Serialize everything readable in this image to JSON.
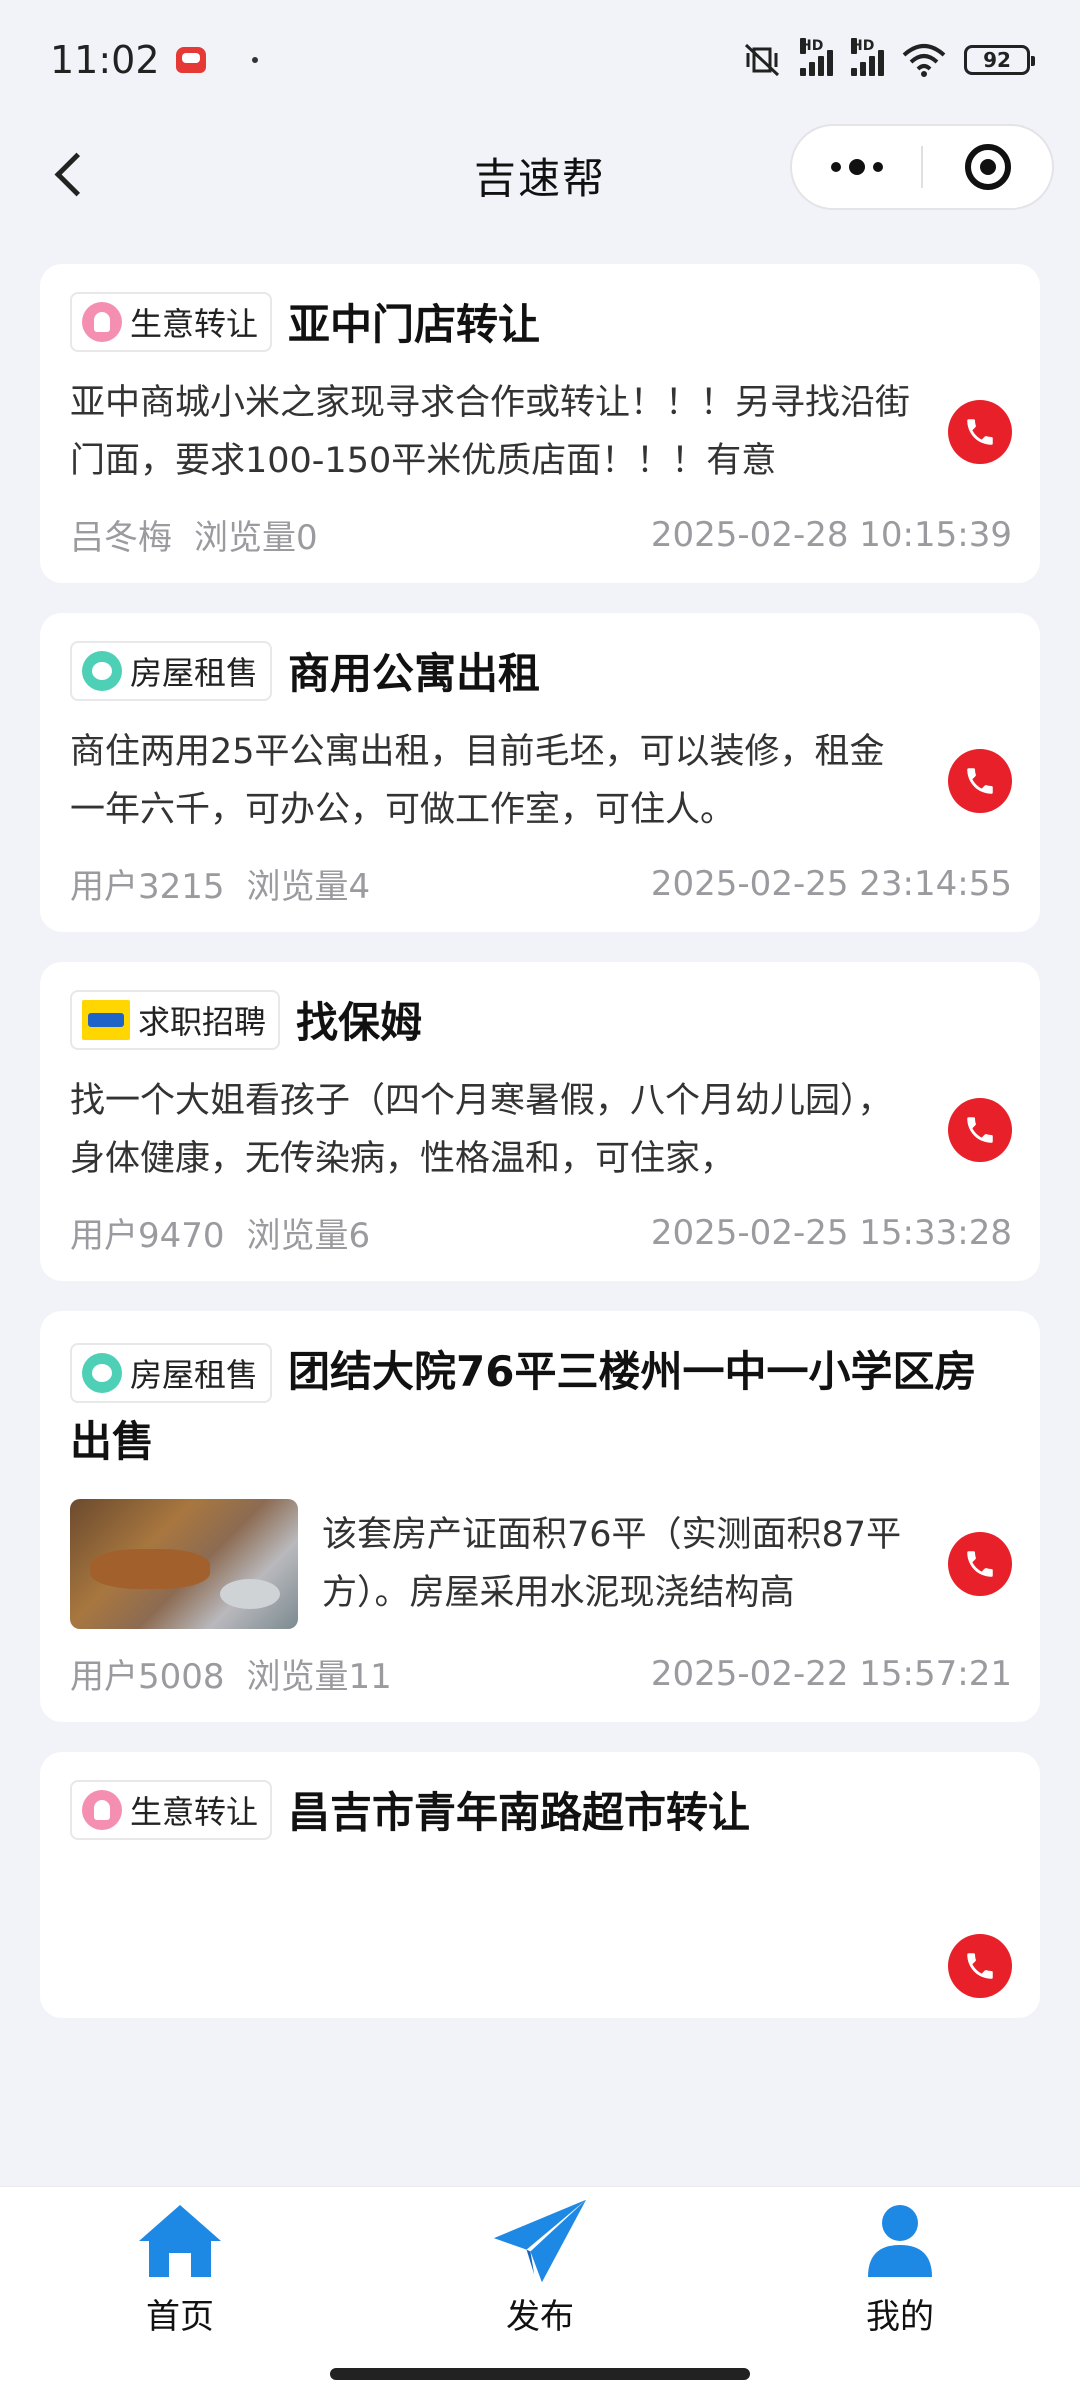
{
  "status": {
    "time": "11:02",
    "battery": "92",
    "network_1": "HD",
    "network_2": "HD"
  },
  "nav": {
    "title": "吉速帮"
  },
  "posts": [
    {
      "category": "生意转让",
      "title": "亚中门店转让",
      "description": "亚中商城小米之家现寻求合作或转让！！！另寻找沿街门面，要求100-150平米优质店面！！！有意",
      "author": "吕冬梅",
      "views": "浏览量0",
      "date": "2025-02-28 10:15:39"
    },
    {
      "category": "房屋租售",
      "title": "商用公寓出租",
      "description": "商住两用25平公寓出租，目前毛坯，可以装修，租金一年六千，可办公，可做工作室，可住人。",
      "author": "用户3215",
      "views": "浏览量4",
      "date": "2025-02-25 23:14:55"
    },
    {
      "category": "求职招聘",
      "title": "找保姆",
      "description": "找一个大姐看孩子（四个月寒暑假，八个月幼儿园），身体健康，无传染病，性格温和，可住家，",
      "author": "用户9470",
      "views": "浏览量6",
      "date": "2025-02-25 15:33:28"
    },
    {
      "category": "房屋租售",
      "title": "团结大院76平三楼州一中一小学区房出售",
      "description": "该套房产证面积76平（实测面积87平方）。房屋采用水泥现浇结构高",
      "author": "用户5008",
      "views": "浏览量11",
      "date": "2025-02-22 15:57:21"
    },
    {
      "category": "生意转让",
      "title": "昌吉市青年南路超市转让"
    }
  ],
  "tabs": [
    {
      "label": "首页",
      "color": "#1e88e5"
    },
    {
      "label": "发布",
      "color": "#1e88e5"
    },
    {
      "label": "我的",
      "color": "#1e88e5"
    }
  ],
  "colors": {
    "call_button": "#e8202a",
    "tab_icon": "#1e88e5",
    "meta_text": "#9a9a9f"
  }
}
